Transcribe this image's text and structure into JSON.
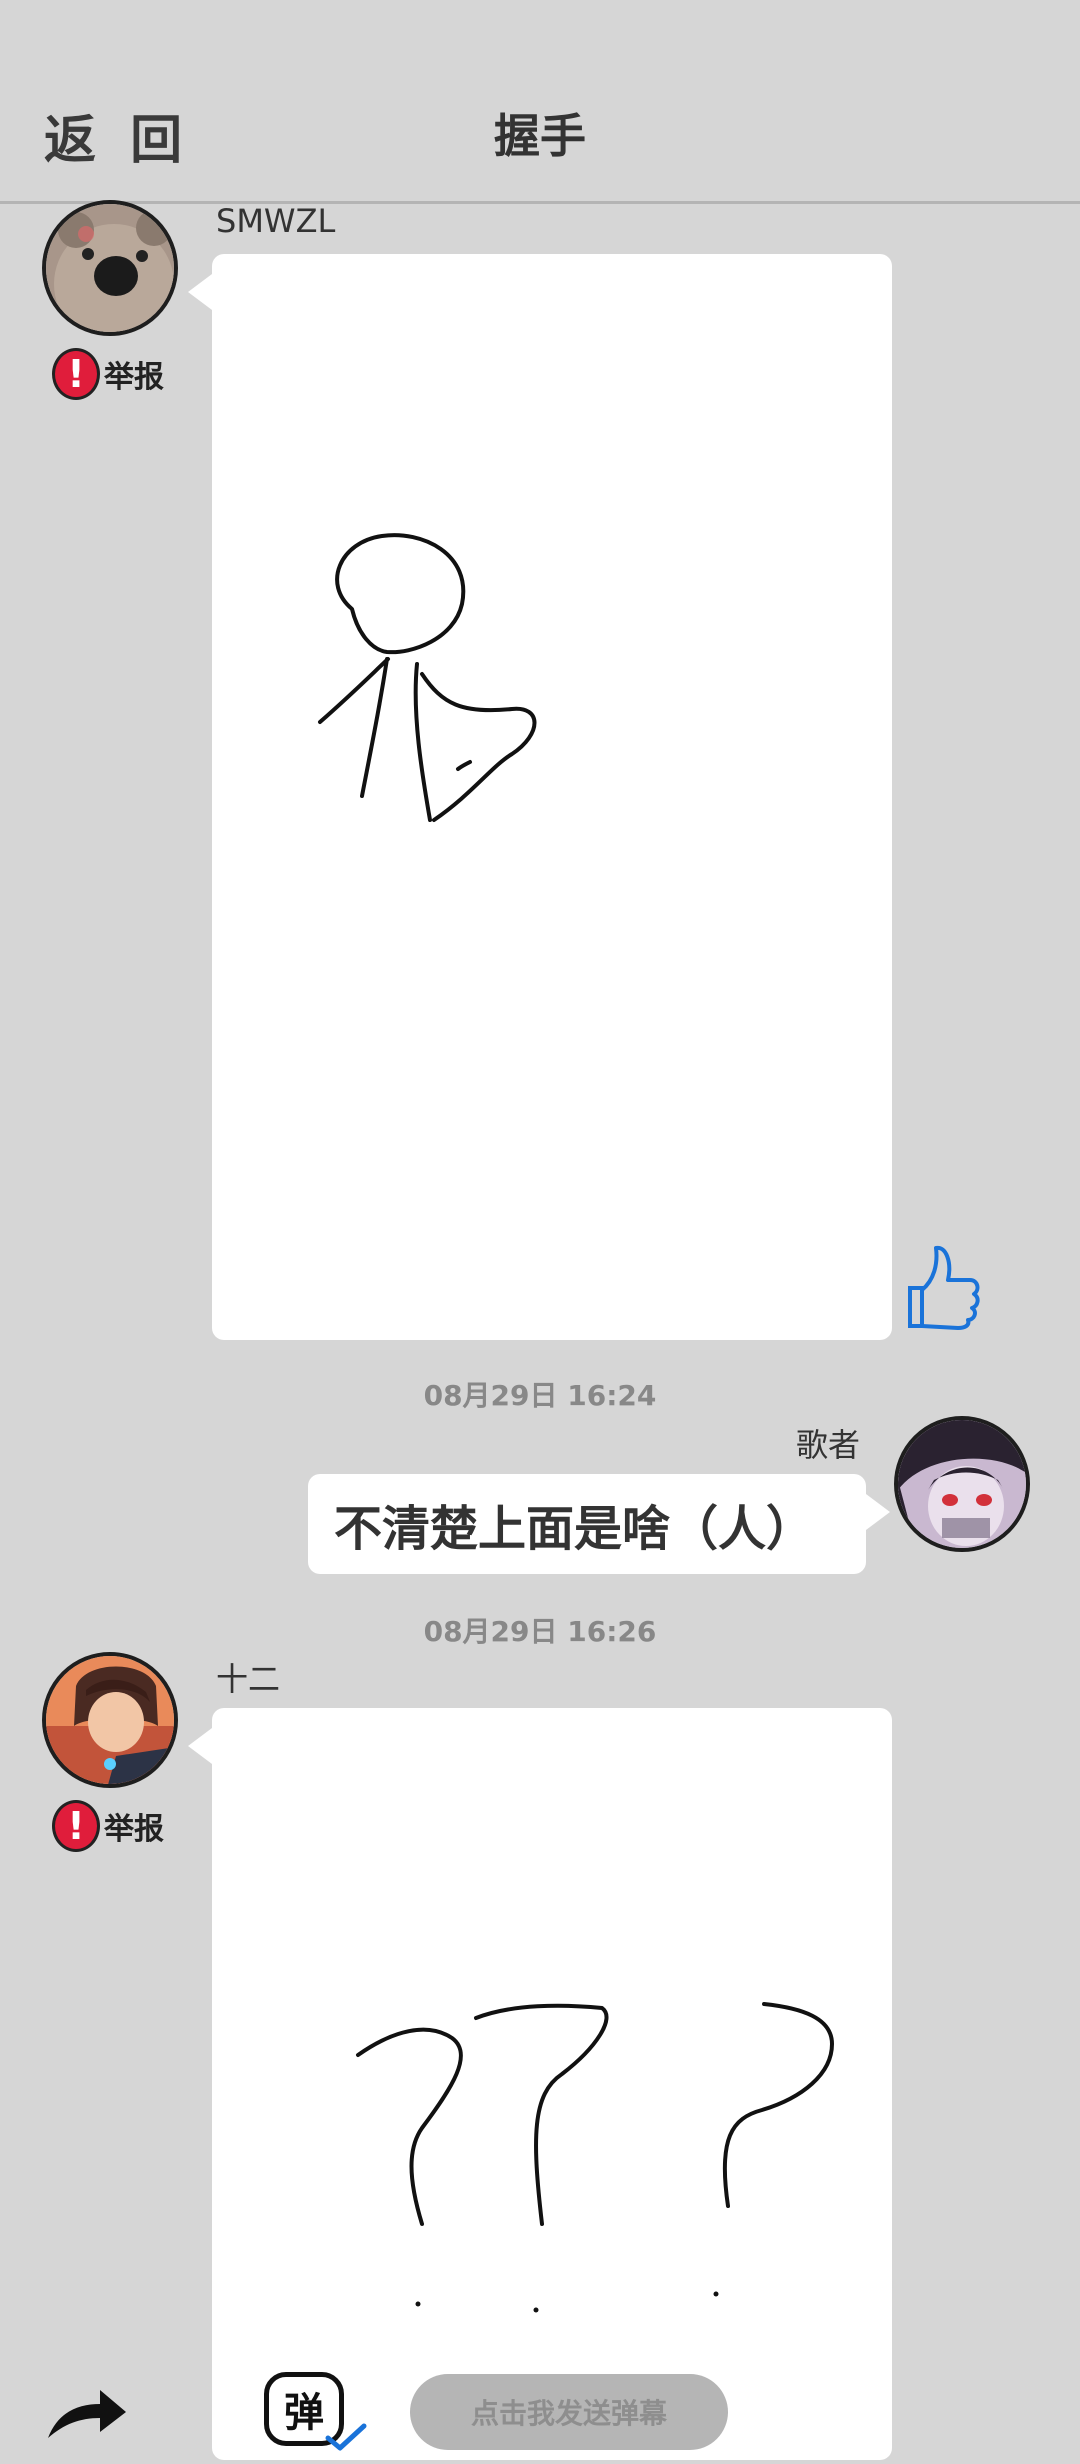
{
  "header": {
    "back_label": "返 回",
    "title": "握手"
  },
  "messages": [
    {
      "user": "SMWZL",
      "report_label": "举报",
      "type": "drawing"
    },
    {
      "timestamp": "08月29日  16:24"
    },
    {
      "user": "歌者",
      "type": "text",
      "text": "不清楚上面是啥（人）"
    },
    {
      "timestamp": "08月29日  16:26"
    },
    {
      "user": "十二",
      "report_label": "举报",
      "type": "drawing"
    }
  ],
  "bottom": {
    "danmu_placeholder": "点击我发送弹幕",
    "danmu_icon_label": "弹"
  },
  "icons": {
    "report": "exclamation-icon",
    "like": "thumbs-up-icon",
    "share": "share-arrow-icon"
  },
  "colors": {
    "background": "#d6d6d6",
    "report_red": "#e01d3b",
    "like_blue": "#1a73d9"
  }
}
